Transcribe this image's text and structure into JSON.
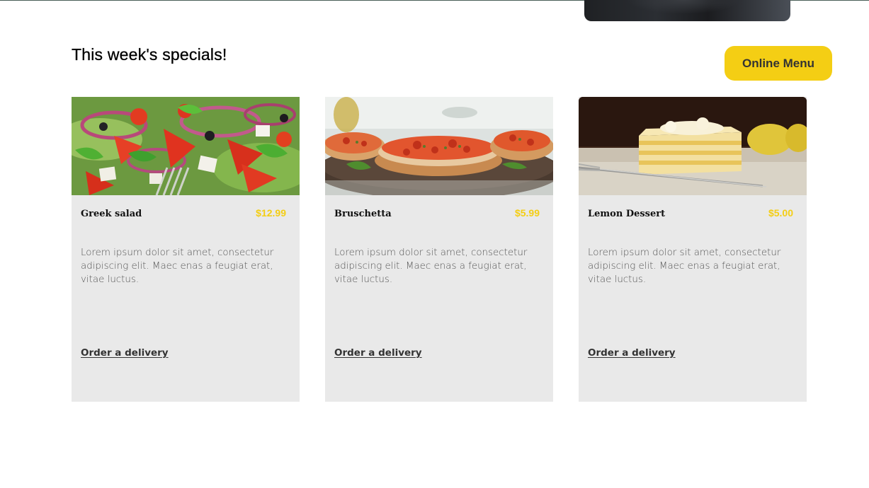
{
  "section": {
    "title": "This week's specials!",
    "online_menu_label": "Online Menu"
  },
  "hero": {
    "image_icon": "hero-food-photo"
  },
  "specials": [
    {
      "name": "Greek salad",
      "price": "$12.99",
      "description": "Lorem ipsum dolor sit amet, consectetur adipiscing elit. Maec enas a feugiat erat, vitae luctus.",
      "link_label": "Order a delivery",
      "image_icon": "greek-salad-photo"
    },
    {
      "name": "Bruschetta",
      "price": "$5.99",
      "description": "Lorem ipsum dolor sit amet, consectetur adipiscing elit. Maec enas a feugiat erat, vitae luctus.",
      "link_label": "Order a delivery",
      "image_icon": "bruschetta-photo"
    },
    {
      "name": "Lemon Dessert",
      "price": "$5.00",
      "description": "Lorem ipsum dolor sit amet, consectetur adipiscing elit. Maec enas a feugiat erat, vitae luctus.",
      "link_label": "Order a delivery",
      "image_icon": "lemon-dessert-photo"
    }
  ],
  "colors": {
    "accent_yellow": "#f4ce14",
    "card_background": "#e9e9e9",
    "rule_green": "#495e57"
  }
}
